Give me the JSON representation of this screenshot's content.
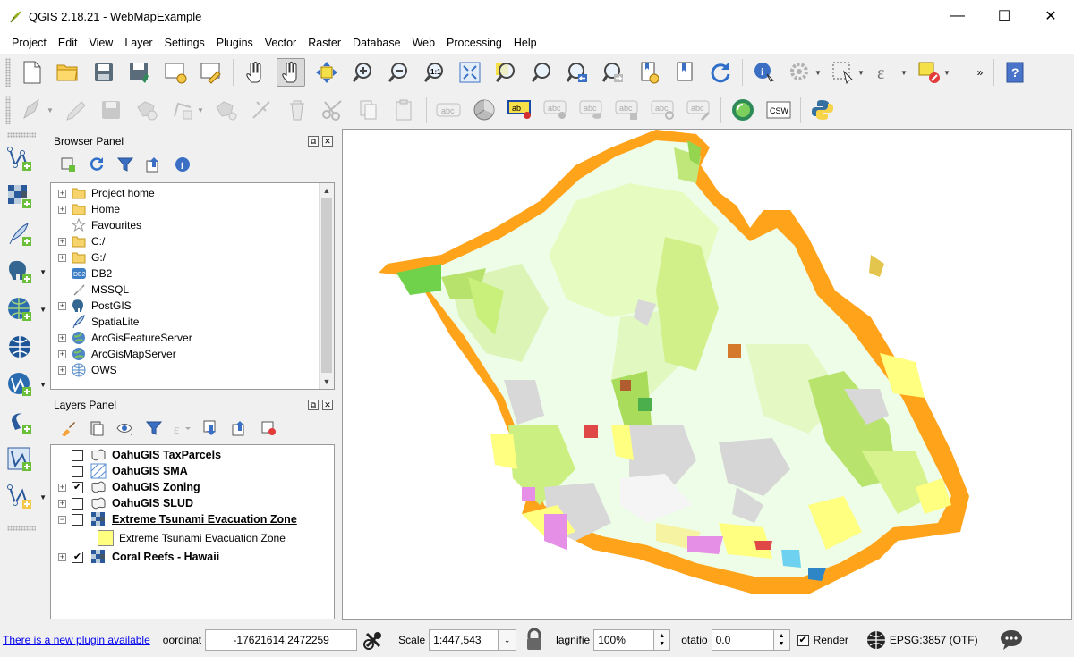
{
  "window": {
    "title": "QGIS 2.18.21 - WebMapExample",
    "controls": {
      "minimize": "—",
      "maximize": "☐",
      "close": "✕"
    }
  },
  "menu": [
    "Project",
    "Edit",
    "View",
    "Layer",
    "Settings",
    "Plugins",
    "Vector",
    "Raster",
    "Database",
    "Web",
    "Processing",
    "Help"
  ],
  "toolbar1": {
    "icons": [
      "new-project-icon",
      "open-project-icon",
      "save-project-icon",
      "save-as-icon",
      "new-print-composer-icon",
      "composer-manager-icon",
      "touch-zoom-pan-icon",
      "pan-map-icon",
      "pan-to-selection-icon",
      "zoom-in-icon",
      "zoom-out-icon",
      "zoom-native-icon",
      "zoom-full-icon",
      "zoom-to-selection-icon",
      "zoom-to-layer-icon",
      "zoom-last-icon",
      "zoom-next-icon",
      "new-bookmark-icon",
      "show-bookmarks-icon",
      "refresh-icon",
      "identify-icon",
      "action-icon",
      "select-feature-icon",
      "expression-select-icon",
      "deselect-icon",
      "help-icon"
    ],
    "overflow": "»"
  },
  "toolbar2": {
    "icons": [
      "current-edits-icon",
      "toggle-editing-icon",
      "save-edits-icon",
      "add-feature-icon",
      "move-feature-icon",
      "node-tool-icon",
      "delete-selected-icon",
      "cut-features-icon",
      "copy-features-icon",
      "paste-features-icon",
      "label-icon",
      "diagram-icon",
      "pin-labels-icon",
      "show-hide-labels-icon",
      "move-label-icon",
      "rotate-label-icon",
      "change-label-icon",
      "metasearch-icon",
      "python-console-icon"
    ],
    "label_text": "abc",
    "csw_text": "CSW",
    "active_label_text": "ab"
  },
  "left_toolbar": [
    "add-vector-layer-icon",
    "add-raster-layer-icon",
    "add-delimited-text-icon",
    "add-postgis-icon",
    "add-wms-icon",
    "add-wcs-icon",
    "add-wfs-icon",
    "add-spatialite-icon",
    "add-virtual-layer-icon",
    "new-shapefile-icon"
  ],
  "browser_panel": {
    "title": "Browser Panel",
    "items": [
      {
        "label": "Project home",
        "icon": "folder-icon",
        "expandable": true
      },
      {
        "label": "Home",
        "icon": "folder-icon",
        "expandable": true
      },
      {
        "label": "Favourites",
        "icon": "star-icon",
        "expandable": false
      },
      {
        "label": "C:/",
        "icon": "folder-icon",
        "expandable": true
      },
      {
        "label": "G:/",
        "icon": "folder-icon",
        "expandable": true
      },
      {
        "label": "DB2",
        "icon": "db2-icon",
        "expandable": false
      },
      {
        "label": "MSSQL",
        "icon": "mssql-icon",
        "expandable": false
      },
      {
        "label": "PostGIS",
        "icon": "postgis-elephant-icon",
        "expandable": true
      },
      {
        "label": "SpatiaLite",
        "icon": "spatialite-feather-icon",
        "expandable": false
      },
      {
        "label": "ArcGisFeatureServer",
        "icon": "arcgis-globe-icon",
        "expandable": true
      },
      {
        "label": "ArcGisMapServer",
        "icon": "arcgis-globe-icon",
        "expandable": true
      },
      {
        "label": "OWS",
        "icon": "ows-globe-icon",
        "expandable": true
      }
    ]
  },
  "layers_panel": {
    "title": "Layers Panel",
    "layers": [
      {
        "label": "OahuGIS TaxParcels",
        "checked": false,
        "expandable": false,
        "icon": "polygon-layer-icon"
      },
      {
        "label": "OahuGIS SMA",
        "checked": false,
        "expandable": false,
        "icon": "hatched-polygon-icon"
      },
      {
        "label": "OahuGIS Zoning",
        "checked": true,
        "expandable": true,
        "icon": "polygon-layer-icon"
      },
      {
        "label": "OahuGIS SLUD",
        "checked": false,
        "expandable": true,
        "icon": "polygon-layer-icon"
      },
      {
        "label": "Extreme Tsunami Evacuation Zone",
        "checked": false,
        "expandable": true,
        "expanded": true,
        "icon": "raster-layer-icon",
        "underlined": true
      },
      {
        "label": "Coral Reefs - Hawaii",
        "checked": true,
        "expandable": true,
        "icon": "raster-layer-icon"
      }
    ],
    "legend_item": {
      "label": "Extreme Tsunami Evacuation Zone",
      "swatch_color": "#ffff80"
    }
  },
  "statusbar": {
    "plugin_notice": "There is a new plugin available",
    "coordinate_label": "oordinat",
    "coordinate_value": "-17621614,2472259",
    "scale_label": "Scale",
    "scale_value": "1:447,543",
    "magnifier_label": "lagnifie",
    "magnifier_value": "100%",
    "rotation_label": "otatio",
    "rotation_value": "0.0",
    "render_label": "Render",
    "render_checked": true,
    "crs": "EPSG:3857 (OTF)"
  },
  "colors": {
    "ocean_buffer": "#ffa31a",
    "tsunami_zone": "#ffff80",
    "land_light": "#eefde8",
    "agriculture": "#e5fbc0",
    "preservation": "#c8f07a",
    "urban_gray": "#d8d8d8",
    "accent_green": "#6fd24a",
    "magenta": "#e68fe6"
  }
}
